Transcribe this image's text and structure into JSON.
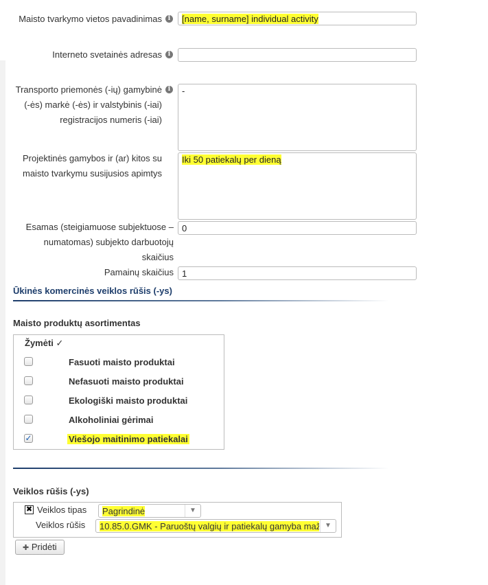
{
  "fields": {
    "name_label": "Maisto tvarkymo vietos pavadinimas",
    "name_value": "[name, surname] individual activity",
    "website_label": "Interneto svetainės adresas",
    "website_value": "",
    "transport_label_line1": "Transporto priemonės (-ių) gamybinė",
    "transport_label_line2": "(-ės) markė (-ės) ir valstybinis (-iai)",
    "transport_label_line3": "registracijos numeris (-iai)",
    "transport_value": "-",
    "production_label_line1": "Projektinės gamybos ir (ar) kitos su",
    "production_label_line2": "maisto tvarkymu susijusios apimtys",
    "production_value": "Iki 50 patiekalų per dieną",
    "employees_label_line1": "Esamas (steigiamuose subjektuose –",
    "employees_label_line2": "numatomas) subjekto darbuotojų",
    "employees_label_line3": "skaičius",
    "employees_value": "0",
    "shifts_label": "Pamainų skaičius",
    "shifts_value": "1"
  },
  "section_title": "Ūkinės komercinės veiklos rūšis (-ys)",
  "assortment": {
    "title": "Maisto produktų asortimentas",
    "mark_header": "Žymėti ✓",
    "items": [
      {
        "label": "Fasuoti maisto produktai",
        "checked": false
      },
      {
        "label": "Nefasuoti maisto produktai",
        "checked": false
      },
      {
        "label": "Ekologiški maisto produktai",
        "checked": false
      },
      {
        "label": "Alkoholiniai gėrimai",
        "checked": false
      },
      {
        "label": "Viešojo maitinimo patiekalai",
        "checked": true
      }
    ]
  },
  "activity": {
    "title": "Veiklos rūšis (-ys)",
    "remove_glyph": "✖",
    "type_label": "Veiklos tipas",
    "type_value": "Pagrindinė",
    "kind_label": "Veiklos rūšis",
    "kind_value": "10.85.0.GMK - Paruoštų valgių ir patiekalų gamyba maž",
    "add_button": "Pridėti",
    "add_glyph": "✚"
  },
  "icons": {
    "info": "info-icon",
    "check": "checkmark-icon",
    "remove": "remove-icon",
    "dropdown": "chevron-down-icon",
    "add": "plus-icon"
  },
  "colors": {
    "highlight": "#ffff33",
    "section_title": "#1d3d6b",
    "checkbox_tick": "#1a5fb4"
  }
}
